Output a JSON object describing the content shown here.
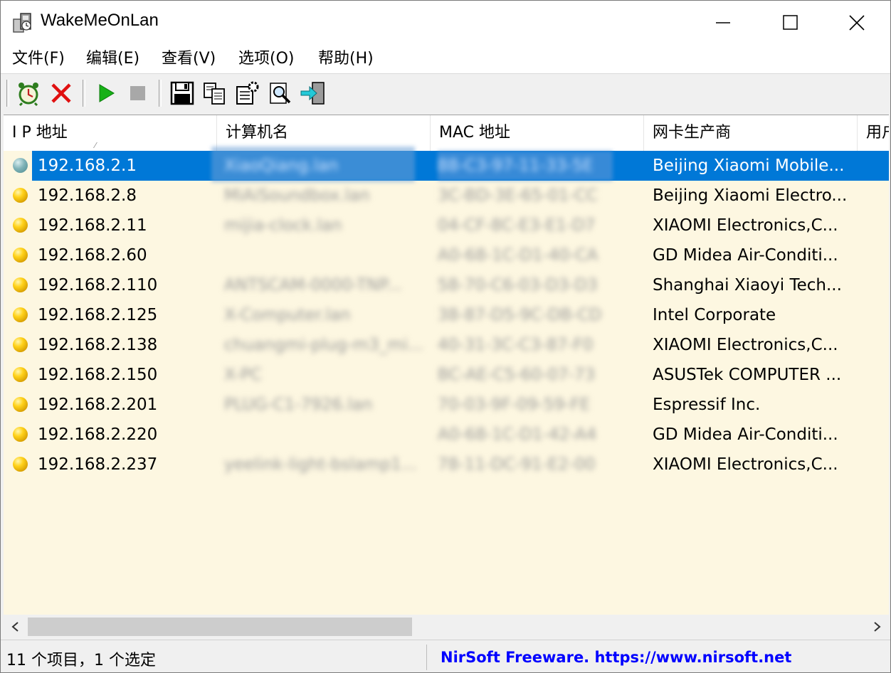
{
  "window": {
    "title": "WakeMeOnLan"
  },
  "menu": [
    "文件(F)",
    "编辑(E)",
    "查看(V)",
    "选项(O)",
    "帮助(H)"
  ],
  "toolbar": {
    "buttons": [
      "alarm-clock-icon",
      "delete-icon",
      "play-icon",
      "stop-icon",
      "save-icon",
      "copy-icon",
      "properties-icon",
      "find-icon",
      "exit-icon"
    ]
  },
  "columns": [
    "I P 地址",
    "计算机名",
    "MAC 地址",
    "网卡生产商",
    "用户"
  ],
  "rows": [
    {
      "ip": "192.168.2.1",
      "host": "XiaoQiang.lan",
      "mac": "88-C3-97-11-33-5E",
      "vendor": "Beijing Xiaomi Mobile...",
      "selected": true
    },
    {
      "ip": "192.168.2.8",
      "host": "MiAiSoundbox.lan",
      "mac": "3C-BD-3E-65-01-CC",
      "vendor": "Beijing Xiaomi Electro..."
    },
    {
      "ip": "192.168.2.11",
      "host": "mijia-clock.lan",
      "mac": "04-CF-8C-E3-E1-D7",
      "vendor": "XIAOMI Electronics,C..."
    },
    {
      "ip": "192.168.2.60",
      "host": "",
      "mac": "A0-68-1C-D1-40-CA",
      "vendor": "GD Midea Air-Conditi..."
    },
    {
      "ip": "192.168.2.110",
      "host": "ANTSCAM-0000-TNP...",
      "mac": "58-70-C6-03-D3-D3",
      "vendor": "Shanghai Xiaoyi Tech..."
    },
    {
      "ip": "192.168.2.125",
      "host": "X-Computer.lan",
      "mac": "38-87-D5-9C-DB-CD",
      "vendor": "Intel Corporate"
    },
    {
      "ip": "192.168.2.138",
      "host": "chuangmi-plug-m3_mi...",
      "mac": "40-31-3C-C3-87-F0",
      "vendor": "XIAOMI Electronics,C..."
    },
    {
      "ip": "192.168.2.150",
      "host": "X-PC",
      "mac": "BC-AE-C5-60-07-73",
      "vendor": "ASUSTek COMPUTER ..."
    },
    {
      "ip": "192.168.2.201",
      "host": "PLUG-C1-7926.lan",
      "mac": "70-03-9F-09-59-FE",
      "vendor": "Espressif Inc."
    },
    {
      "ip": "192.168.2.220",
      "host": "",
      "mac": "A0-68-1C-D1-42-A4",
      "vendor": "GD Midea Air-Conditi..."
    },
    {
      "ip": "192.168.2.237",
      "host": "yeelink-light-bslamp1...",
      "mac": "78-11-DC-91-E2-00",
      "vendor": "XIAOMI Electronics,C..."
    }
  ],
  "status": {
    "left": "11 个项目，1 个选定",
    "right": "NirSoft Freeware. https://www.nirsoft.net"
  }
}
